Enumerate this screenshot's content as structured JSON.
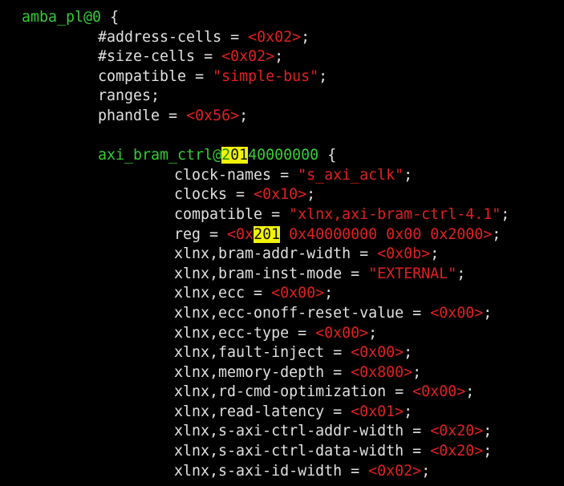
{
  "editor": {
    "colors": {
      "background": "#000000",
      "node_name": "#33cc33",
      "property": "#e0e0e0",
      "value": "#e02020",
      "search_highlight": "#f2f20a"
    },
    "lines": [
      {
        "indent": 0,
        "parts": [
          {
            "t": "amba_pl@0",
            "c": "node"
          },
          {
            "t": " {",
            "c": "txt"
          }
        ]
      },
      {
        "indent": 1,
        "parts": [
          {
            "t": "#address-cells = ",
            "c": "txt"
          },
          {
            "t": "<0x02>",
            "c": "red"
          },
          {
            "t": ";",
            "c": "txt"
          }
        ]
      },
      {
        "indent": 1,
        "parts": [
          {
            "t": "#size-cells = ",
            "c": "txt"
          },
          {
            "t": "<0x02>",
            "c": "red"
          },
          {
            "t": ";",
            "c": "txt"
          }
        ]
      },
      {
        "indent": 1,
        "parts": [
          {
            "t": "compatible = ",
            "c": "txt"
          },
          {
            "t": "\"simple-bus\"",
            "c": "red"
          },
          {
            "t": ";",
            "c": "txt"
          }
        ]
      },
      {
        "indent": 1,
        "parts": [
          {
            "t": "ranges;",
            "c": "txt"
          }
        ]
      },
      {
        "indent": 1,
        "parts": [
          {
            "t": "phandle = ",
            "c": "txt"
          },
          {
            "t": "<0x56>",
            "c": "red"
          },
          {
            "t": ";",
            "c": "txt"
          }
        ]
      },
      {
        "indent": 0,
        "parts": []
      },
      {
        "indent": 1,
        "parts": [
          {
            "t": "axi_bram_ctrl@",
            "c": "node"
          },
          {
            "t": "2",
            "c": "hl-grn"
          },
          {
            "t": "01",
            "c": "hl"
          },
          {
            "t": "40000000",
            "c": "node"
          },
          {
            "t": " {",
            "c": "txt"
          }
        ]
      },
      {
        "indent": 2,
        "parts": [
          {
            "t": "clock-names = ",
            "c": "txt"
          },
          {
            "t": "\"s_axi_aclk\"",
            "c": "red"
          },
          {
            "t": ";",
            "c": "txt"
          }
        ]
      },
      {
        "indent": 2,
        "parts": [
          {
            "t": "clocks = ",
            "c": "txt"
          },
          {
            "t": "<0x10>",
            "c": "red"
          },
          {
            "t": ";",
            "c": "txt"
          }
        ]
      },
      {
        "indent": 2,
        "parts": [
          {
            "t": "compatible = ",
            "c": "txt"
          },
          {
            "t": "\"xlnx,axi-bram-ctrl-4.1\"",
            "c": "red"
          },
          {
            "t": ";",
            "c": "txt"
          }
        ]
      },
      {
        "indent": 2,
        "parts": [
          {
            "t": "reg = ",
            "c": "txt"
          },
          {
            "t": "<0x",
            "c": "red"
          },
          {
            "t": "201",
            "c": "hl"
          },
          {
            "t": " 0x40000000 0x00 0x2000>",
            "c": "red"
          },
          {
            "t": ";",
            "c": "txt"
          }
        ]
      },
      {
        "indent": 2,
        "parts": [
          {
            "t": "xlnx,bram-addr-width = ",
            "c": "txt"
          },
          {
            "t": "<0x0b>",
            "c": "red"
          },
          {
            "t": ";",
            "c": "txt"
          }
        ]
      },
      {
        "indent": 2,
        "parts": [
          {
            "t": "xlnx,bram-inst-mode = ",
            "c": "txt"
          },
          {
            "t": "\"EXTERNAL\"",
            "c": "red"
          },
          {
            "t": ";",
            "c": "txt"
          }
        ]
      },
      {
        "indent": 2,
        "parts": [
          {
            "t": "xlnx,ecc = ",
            "c": "txt"
          },
          {
            "t": "<0x00>",
            "c": "red"
          },
          {
            "t": ";",
            "c": "txt"
          }
        ]
      },
      {
        "indent": 2,
        "parts": [
          {
            "t": "xlnx,ecc-onoff-reset-value = ",
            "c": "txt"
          },
          {
            "t": "<0x00>",
            "c": "red"
          },
          {
            "t": ";",
            "c": "txt"
          }
        ]
      },
      {
        "indent": 2,
        "parts": [
          {
            "t": "xlnx,ecc-type = ",
            "c": "txt"
          },
          {
            "t": "<0x00>",
            "c": "red"
          },
          {
            "t": ";",
            "c": "txt"
          }
        ]
      },
      {
        "indent": 2,
        "parts": [
          {
            "t": "xlnx,fault-inject = ",
            "c": "txt"
          },
          {
            "t": "<0x00>",
            "c": "red"
          },
          {
            "t": ";",
            "c": "txt"
          }
        ]
      },
      {
        "indent": 2,
        "parts": [
          {
            "t": "xlnx,memory-depth = ",
            "c": "txt"
          },
          {
            "t": "<0x800>",
            "c": "red"
          },
          {
            "t": ";",
            "c": "txt"
          }
        ]
      },
      {
        "indent": 2,
        "parts": [
          {
            "t": "xlnx,rd-cmd-optimization = ",
            "c": "txt"
          },
          {
            "t": "<0x00>",
            "c": "red"
          },
          {
            "t": ";",
            "c": "txt"
          }
        ]
      },
      {
        "indent": 2,
        "parts": [
          {
            "t": "xlnx,read-latency = ",
            "c": "txt"
          },
          {
            "t": "<0x01>",
            "c": "red"
          },
          {
            "t": ";",
            "c": "txt"
          }
        ]
      },
      {
        "indent": 2,
        "parts": [
          {
            "t": "xlnx,s-axi-ctrl-addr-width = ",
            "c": "txt"
          },
          {
            "t": "<0x20>",
            "c": "red"
          },
          {
            "t": ";",
            "c": "txt"
          }
        ]
      },
      {
        "indent": 2,
        "parts": [
          {
            "t": "xlnx,s-axi-ctrl-data-width = ",
            "c": "txt"
          },
          {
            "t": "<0x20>",
            "c": "red"
          },
          {
            "t": ";",
            "c": "txt"
          }
        ]
      },
      {
        "indent": 2,
        "parts": [
          {
            "t": "xlnx,s-axi-id-width = ",
            "c": "txt"
          },
          {
            "t": "<0x02>",
            "c": "red"
          },
          {
            "t": ";",
            "c": "txt"
          }
        ]
      }
    ]
  }
}
